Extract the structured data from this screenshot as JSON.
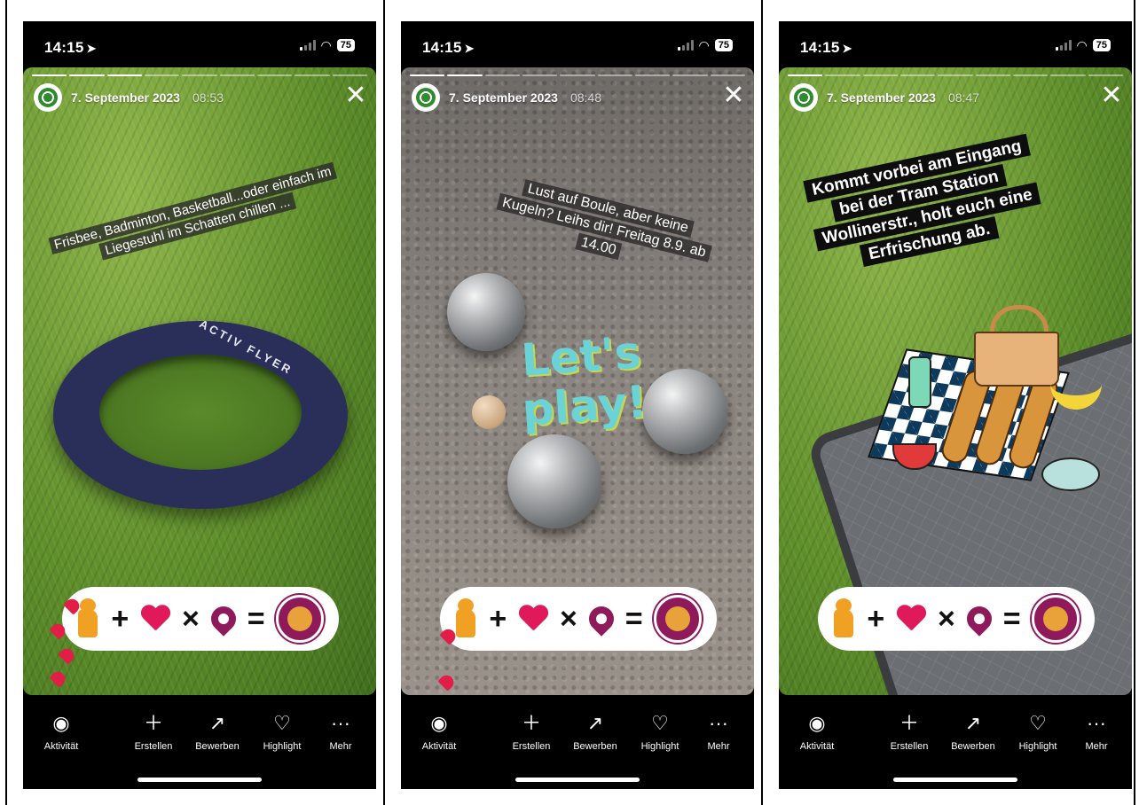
{
  "screens": [
    {
      "status": {
        "time": "14:15",
        "battery": "75"
      },
      "story": {
        "date": "7. September 2023",
        "time": "08:53",
        "caption": "Frisbee, Badminton, Basketball...oder einfach im Liegestuhl im Schatten chillen ...",
        "frisbee_text": "ACTIV FLYER",
        "sticker": {
          "plus": "+",
          "times": "×",
          "equals": "="
        }
      },
      "nav": [
        {
          "label": "Aktivität",
          "icon": "eye-icon"
        },
        {
          "label": "Erstellen",
          "icon": "plus-icon"
        },
        {
          "label": "Bewerben",
          "icon": "trend-icon"
        },
        {
          "label": "Highlight",
          "icon": "highlight-icon"
        },
        {
          "label": "Mehr",
          "icon": "more-icon"
        }
      ]
    },
    {
      "status": {
        "time": "14:15",
        "battery": "75"
      },
      "story": {
        "date": "7. September 2023",
        "time": "08:48",
        "caption": "Lust auf Boule, aber keine Kugeln? Leihs dir! Freitag 8.9. ab 14.00",
        "title_line1": "Let's",
        "title_line2": "play!",
        "sticker": {
          "plus": "+",
          "times": "×",
          "equals": "="
        }
      },
      "nav": [
        {
          "label": "Aktivität",
          "icon": "eye-icon"
        },
        {
          "label": "Erstellen",
          "icon": "plus-icon"
        },
        {
          "label": "Bewerben",
          "icon": "trend-icon"
        },
        {
          "label": "Highlight",
          "icon": "highlight-icon"
        },
        {
          "label": "Mehr",
          "icon": "more-icon"
        }
      ]
    },
    {
      "status": {
        "time": "14:15",
        "battery": "75"
      },
      "story": {
        "date": "7. September 2023",
        "time": "08:47",
        "caption": "Kommt vorbei am Eingang bei der Tram Station Wollinerstr., holt euch eine Erfrischung ab.",
        "sticker": {
          "plus": "+",
          "times": "×",
          "equals": "="
        }
      },
      "nav": [
        {
          "label": "Aktivität",
          "icon": "eye-icon"
        },
        {
          "label": "Erstellen",
          "icon": "plus-icon"
        },
        {
          "label": "Bewerben",
          "icon": "trend-icon"
        },
        {
          "label": "Highlight",
          "icon": "highlight-icon"
        },
        {
          "label": "Mehr",
          "icon": "more-icon"
        }
      ]
    }
  ],
  "colors": {
    "heart": "#e0195a",
    "pin": "#8e1a5c",
    "bear": "#f0a023",
    "lets_play": "#6bd3d6"
  }
}
